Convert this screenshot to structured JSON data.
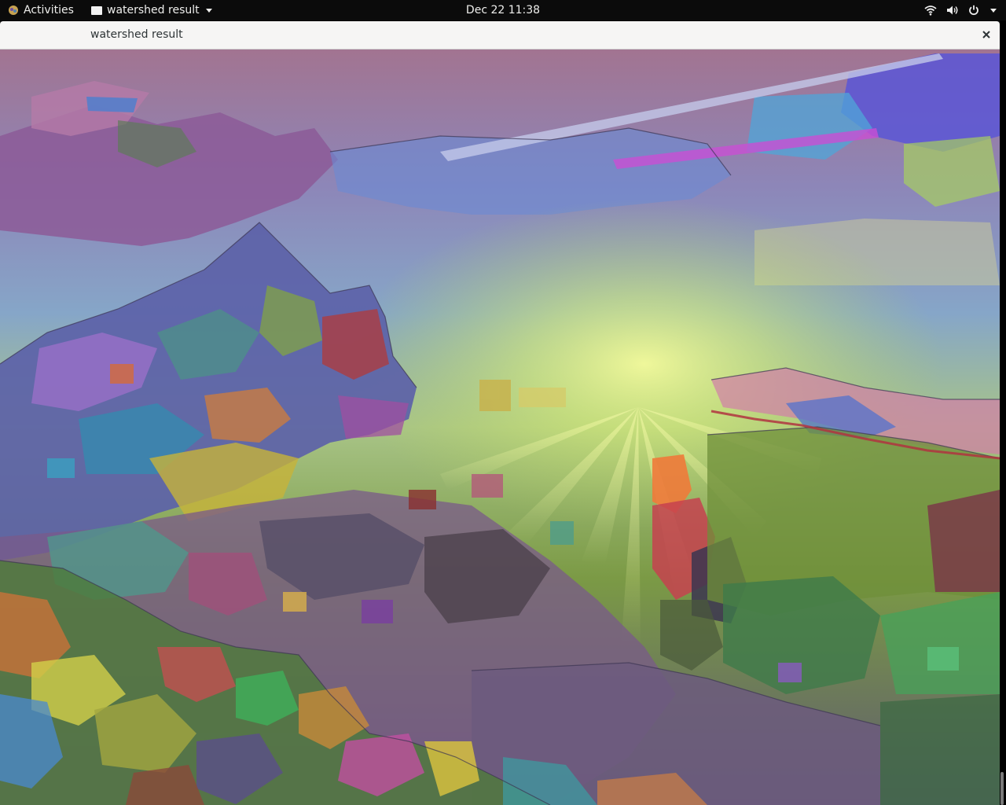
{
  "topbar": {
    "activities_label": "Activities",
    "app_name": "watershed result",
    "clock": "Dec 22  11:38",
    "status_icons": [
      "wifi-icon",
      "volume-icon",
      "power-icon",
      "chevron-down-icon"
    ]
  },
  "window": {
    "title": "watershed result",
    "close_glyph": "✕"
  },
  "image": {
    "description_icon": "segmented-landscape-image",
    "palette": {
      "sky_top": "#9c6d8d",
      "sky_mid": "#7f9fc6",
      "sun_glow": "#d9f07a",
      "mountain": "#6a6ab0",
      "meadow": "#7a8a3a",
      "foreground": "#6a5a7a"
    }
  }
}
